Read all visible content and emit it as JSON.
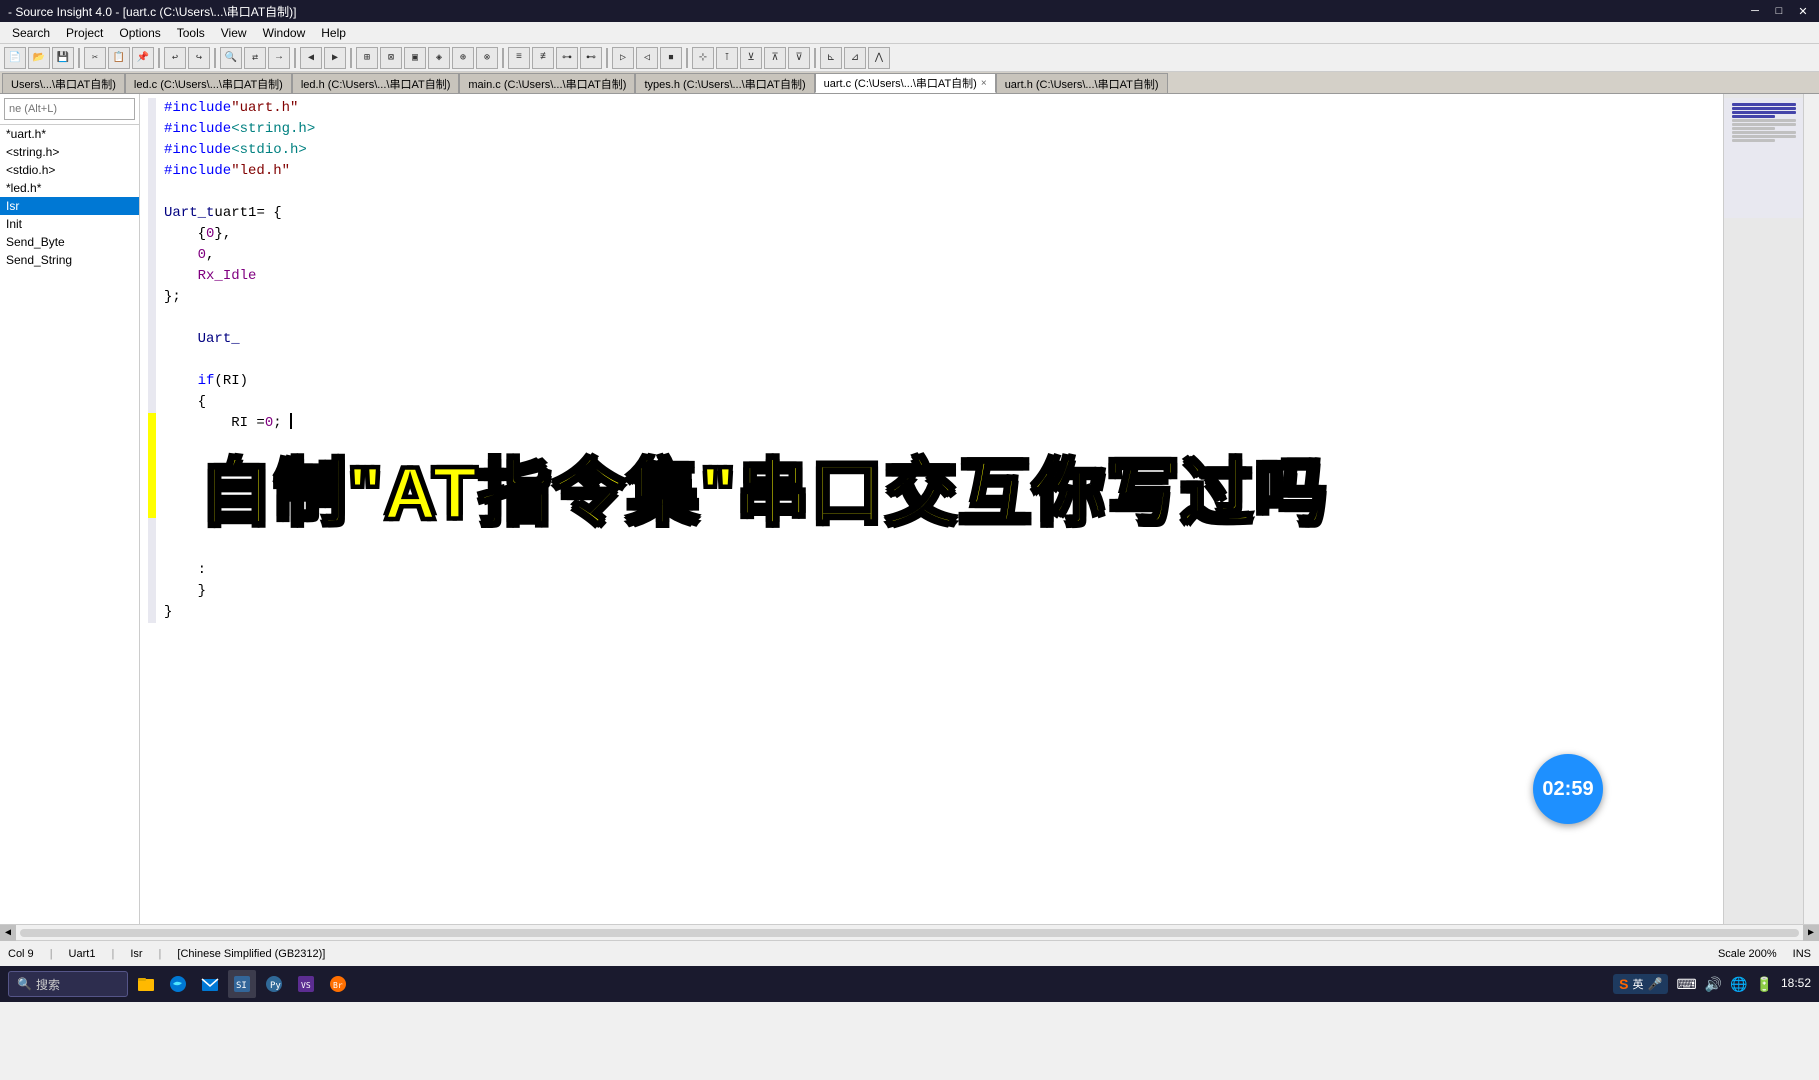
{
  "window": {
    "title": "- Source Insight 4.0 - [uart.c (C:\\Users\\...\\串口AT自制)]",
    "full_title": "- Source Insight 4.0 - [uart.c (C:\\Users\\...\\串口AT自制)]"
  },
  "window_controls": {
    "minimize": "─",
    "maximize": "□",
    "close": "✕"
  },
  "menu": {
    "items": [
      "Search",
      "Project",
      "Options",
      "Tools",
      "View",
      "Window",
      "Help"
    ]
  },
  "tabs": [
    {
      "label": "Users\\...\\串口AT自制)",
      "closable": false,
      "active": false
    },
    {
      "label": "led.c (C:\\Users\\...\\串口AT自制)",
      "closable": false,
      "active": false
    },
    {
      "label": "led.h (C:\\Users\\...\\串口AT自制)",
      "closable": false,
      "active": false
    },
    {
      "label": "main.c (C:\\Users\\...\\串口AT自制)",
      "closable": false,
      "active": false
    },
    {
      "label": "types.h (C:\\Users\\...\\串口AT自制)",
      "closable": false,
      "active": false
    },
    {
      "label": "uart.c (C:\\Users\\...\\串口AT自制)",
      "closable": true,
      "active": true
    },
    {
      "label": "uart.h (C:\\Users\\...\\串口AT自制)",
      "closable": false,
      "active": false
    }
  ],
  "sidebar": {
    "search_placeholder": "ne (Alt+L)",
    "items": [
      {
        "label": "*uart.h*",
        "selected": false
      },
      {
        "label": "<string.h>",
        "selected": false
      },
      {
        "label": "<stdio.h>",
        "selected": false
      },
      {
        "label": "*led.h*",
        "selected": false
      },
      {
        "label": "Isr",
        "selected": true
      },
      {
        "label": "Init",
        "selected": false
      },
      {
        "label": "Send_Byte",
        "selected": false
      },
      {
        "label": "Send_String",
        "selected": false
      }
    ]
  },
  "code": {
    "lines": [
      {
        "text": "#include \"uart.h\"",
        "gutter": ""
      },
      {
        "text": "#include <string.h>",
        "gutter": ""
      },
      {
        "text": "#include <stdio.h>",
        "gutter": ""
      },
      {
        "text": "#include \"led.h\"",
        "gutter": ""
      },
      {
        "text": "",
        "gutter": ""
      },
      {
        "text": "Uart_t uart1 = {",
        "gutter": ""
      },
      {
        "text": "    {0},",
        "gutter": ""
      },
      {
        "text": "    0,",
        "gutter": ""
      },
      {
        "text": "    Rx_Idle",
        "gutter": ""
      },
      {
        "text": "};",
        "gutter": ""
      },
      {
        "text": "",
        "gutter": ""
      },
      {
        "text": "    Uart_",
        "gutter": ""
      },
      {
        "text": "",
        "gutter": ""
      },
      {
        "text": "    if (RI)",
        "gutter": ""
      },
      {
        "text": "    {",
        "gutter": ""
      },
      {
        "text": "        RI = 0;",
        "gutter": "yellow"
      },
      {
        "text": "",
        "gutter": "yellow"
      },
      {
        "text": "",
        "gutter": "yellow"
      },
      {
        "text": "",
        "gutter": "yellow"
      },
      {
        "text": "",
        "gutter": "yellow"
      },
      {
        "text": "",
        "gutter": ""
      },
      {
        "text": "",
        "gutter": ""
      },
      {
        "text": "    :",
        "gutter": ""
      },
      {
        "text": "    }",
        "gutter": ""
      },
      {
        "text": "}",
        "gutter": ""
      }
    ]
  },
  "overlay": {
    "text": "自制\"AT指令集\"串口交互你写过吗"
  },
  "timer": {
    "value": "02:59"
  },
  "status_bar": {
    "col": "Col 9",
    "function": "Uart1",
    "isr_label": "Isr",
    "encoding": "[Chinese Simplified (GB2312)]",
    "scale": "Scale 200%",
    "mode": "INS"
  },
  "taskbar": {
    "search_text": "搜索",
    "time": "18:52",
    "date": ""
  },
  "toolbar_icons": [
    "open",
    "save",
    "print",
    "cut",
    "copy",
    "paste",
    "undo",
    "redo",
    "find",
    "replace",
    "goto",
    "back",
    "fwd",
    "symbol",
    "browse",
    "sync"
  ]
}
